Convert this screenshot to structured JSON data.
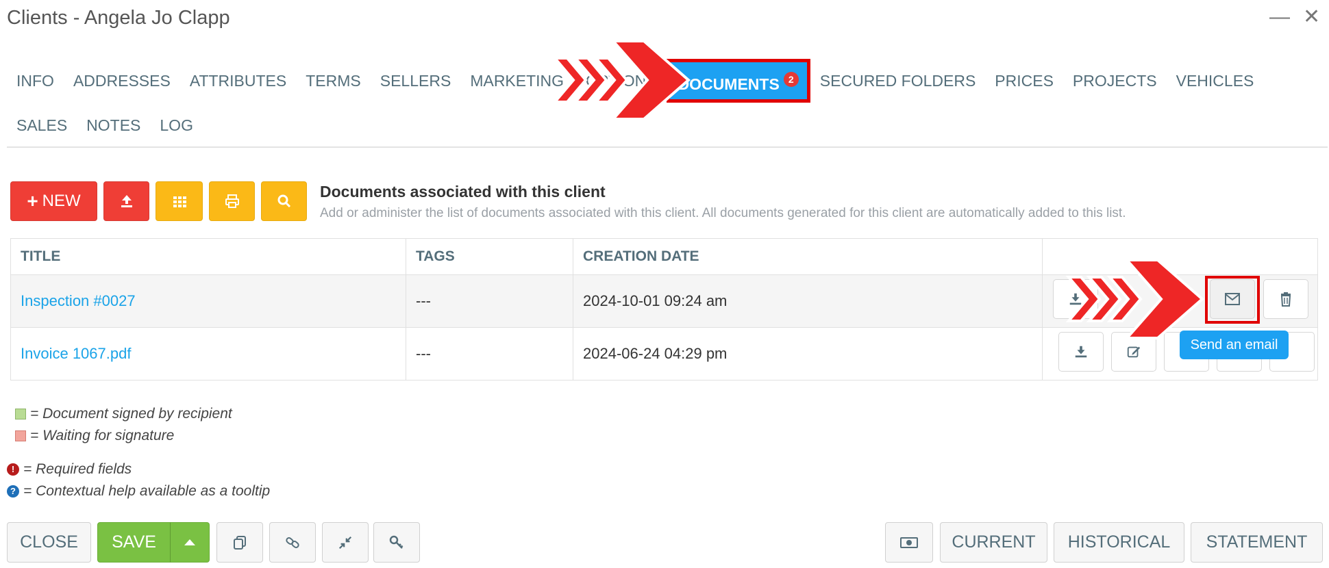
{
  "window": {
    "title": "Clients - Angela Jo Clapp"
  },
  "tabs": [
    {
      "label": "INFO"
    },
    {
      "label": "ADDRESSES"
    },
    {
      "label": "ATTRIBUTES"
    },
    {
      "label": "TERMS"
    },
    {
      "label": "SELLERS"
    },
    {
      "label": "MARKETING"
    },
    {
      "label": "OPTIONS"
    },
    {
      "label": "DOCUMENTS",
      "badge": "2",
      "active": true
    },
    {
      "label": "SECURED FOLDERS"
    },
    {
      "label": "PRICES"
    },
    {
      "label": "PROJECTS"
    },
    {
      "label": "VEHICLES"
    },
    {
      "label": "SALES"
    },
    {
      "label": "NOTES"
    },
    {
      "label": "LOG"
    }
  ],
  "toolbar": {
    "new_label": "NEW"
  },
  "section": {
    "title": "Documents associated with this client",
    "subtitle": "Add or administer the list of documents associated with this client. All documents generated for this client are automatically added to this list."
  },
  "table": {
    "headers": [
      "TITLE",
      "TAGS",
      "CREATION DATE",
      ""
    ],
    "rows": [
      {
        "title": "Inspection #0027",
        "tags": "---",
        "date": "2024-10-01 09:24 am"
      },
      {
        "title": "Invoice 1067.pdf",
        "tags": "---",
        "date": "2024-06-24 04:29 pm"
      }
    ]
  },
  "tooltip": "Send an email",
  "legend": {
    "signed": "= Document signed by recipient",
    "waiting": "= Waiting for signature",
    "required": "= Required fields",
    "help": "= Contextual help available as a tooltip"
  },
  "footer": {
    "close": "CLOSE",
    "save": "SAVE",
    "current": "CURRENT",
    "historical": "HISTORICAL",
    "statement": "STATEMENT"
  },
  "colors": {
    "accent": "#1da1f2",
    "danger": "#ef3e36",
    "warning": "#fbb917",
    "success": "#7ac143",
    "signed": "#b9dc94",
    "waiting": "#f2a59c"
  },
  "icons": [
    "minimize-icon",
    "close-icon",
    "plus-icon",
    "upload-icon",
    "grid-icon",
    "print-icon",
    "search-icon",
    "download-icon",
    "edit-icon",
    "mail-icon",
    "trash-icon",
    "copy-icon",
    "link-icon",
    "compress-icon",
    "key-icon",
    "money-icon",
    "caret-up-icon"
  ]
}
